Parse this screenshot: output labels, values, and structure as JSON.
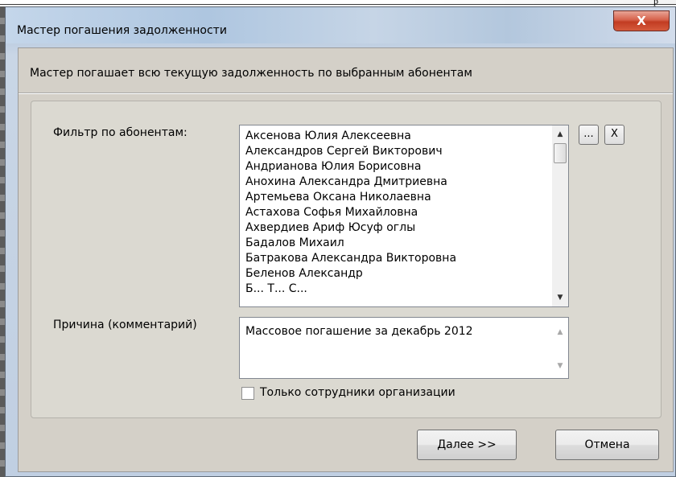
{
  "backdrop": {
    "corner_text": "р"
  },
  "window": {
    "title": "Мастер погашения задолженности",
    "close_glyph": "X"
  },
  "wizard": {
    "description": "Мастер погашает всю текущую задолженность по выбранным абонентам",
    "filter_label": "Фильтр по абонентам:",
    "subscribers": [
      "Аксенова Юлия Алексеевна",
      "Александров Сергей Викторович",
      "Андрианова Юлия Борисовна",
      "Анохина Александра Дмитриевна",
      "Артемьева Оксана Николаевна",
      "Астахова Софья Михайловна",
      "Ахвердиев Ариф Юсуф оглы",
      "Бадалов Михаил",
      "Батракова Александра Викторовна",
      "Беленов Александр",
      "Б... Т... С..."
    ],
    "browse_button": "...",
    "clear_button": "X",
    "reason_label": "Причина (комментарий)",
    "reason_value": "Массовое погашение за декабрь 2012",
    "employees_only_label": "Только сотрудники организации",
    "employees_only_checked": false
  },
  "buttons": {
    "next": "Далее >>",
    "cancel": "Отмена"
  },
  "icons": {
    "scroll_up": "scroll-up-arrow-icon",
    "scroll_down": "scroll-down-arrow-icon"
  }
}
